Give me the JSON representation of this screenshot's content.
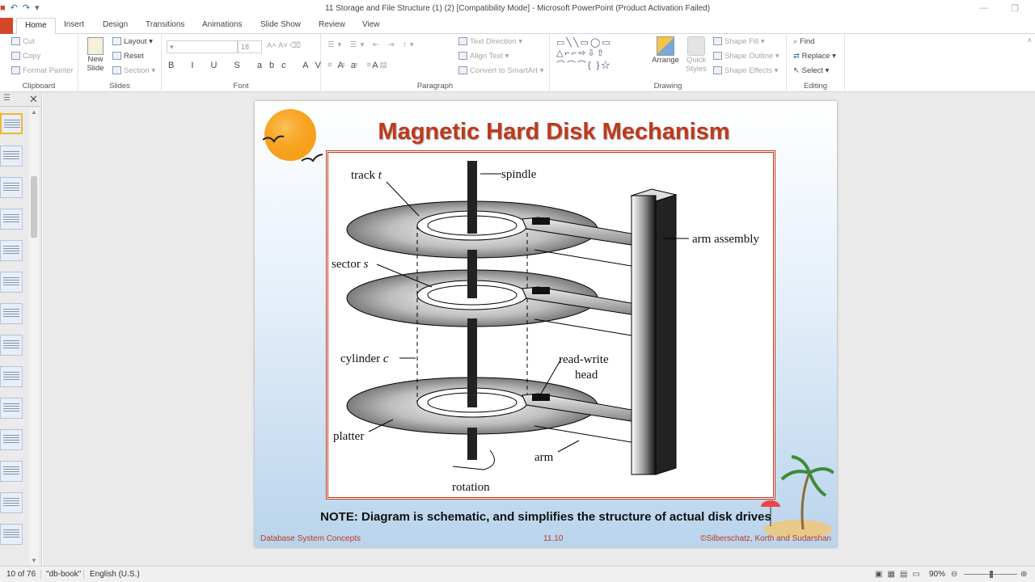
{
  "window": {
    "title": "11 Storage and File Structure (1) (2) [Compatibility Mode]  -  Microsoft PowerPoint (Product Activation Failed)"
  },
  "tabs": [
    "Home",
    "Insert",
    "Design",
    "Transitions",
    "Animations",
    "Slide Show",
    "Review",
    "View"
  ],
  "ribbon": {
    "clipboard": {
      "label": "Clipboard",
      "cut": "Cut",
      "copy": "Copy",
      "format_painter": "Format Painter"
    },
    "slides": {
      "label": "Slides",
      "new_slide": "New Slide",
      "layout": "Layout",
      "reset": "Reset",
      "section": "Section"
    },
    "font": {
      "label": "Font",
      "size": "18"
    },
    "paragraph": {
      "label": "Paragraph",
      "text_direction": "Text Direction",
      "align_text": "Align Text",
      "convert_smartart": "Convert to SmartArt"
    },
    "drawing": {
      "label": "Drawing",
      "arrange": "Arrange",
      "quick_styles": "Quick Styles",
      "shape_fill": "Shape Fill",
      "shape_outline": "Shape Outline",
      "shape_effects": "Shape Effects"
    },
    "editing": {
      "label": "Editing",
      "find": "Find",
      "replace": "Replace",
      "select": "Select"
    }
  },
  "slide": {
    "title": "Magnetic Hard Disk Mechanism",
    "note": "NOTE: Diagram is schematic, and simplifies the structure of actual disk drives",
    "footer_left": "Database System Concepts",
    "footer_center": "11.10",
    "footer_right": "©Silberschatz, Korth and Sudarshan",
    "diagram": {
      "track": "track",
      "track_var": "t",
      "spindle": "spindle",
      "arm_assembly": "arm assembly",
      "sector": "sector",
      "sector_var": "s",
      "cylinder": "cylinder",
      "cylinder_var": "c",
      "rw_head_1": "read-write",
      "rw_head_2": "head",
      "platter": "platter",
      "arm": "arm",
      "rotation": "rotation"
    }
  },
  "status": {
    "slide_pos": "10 of 76",
    "theme": "\"db-book\"",
    "language": "English (U.S.)",
    "zoom": "90%"
  }
}
